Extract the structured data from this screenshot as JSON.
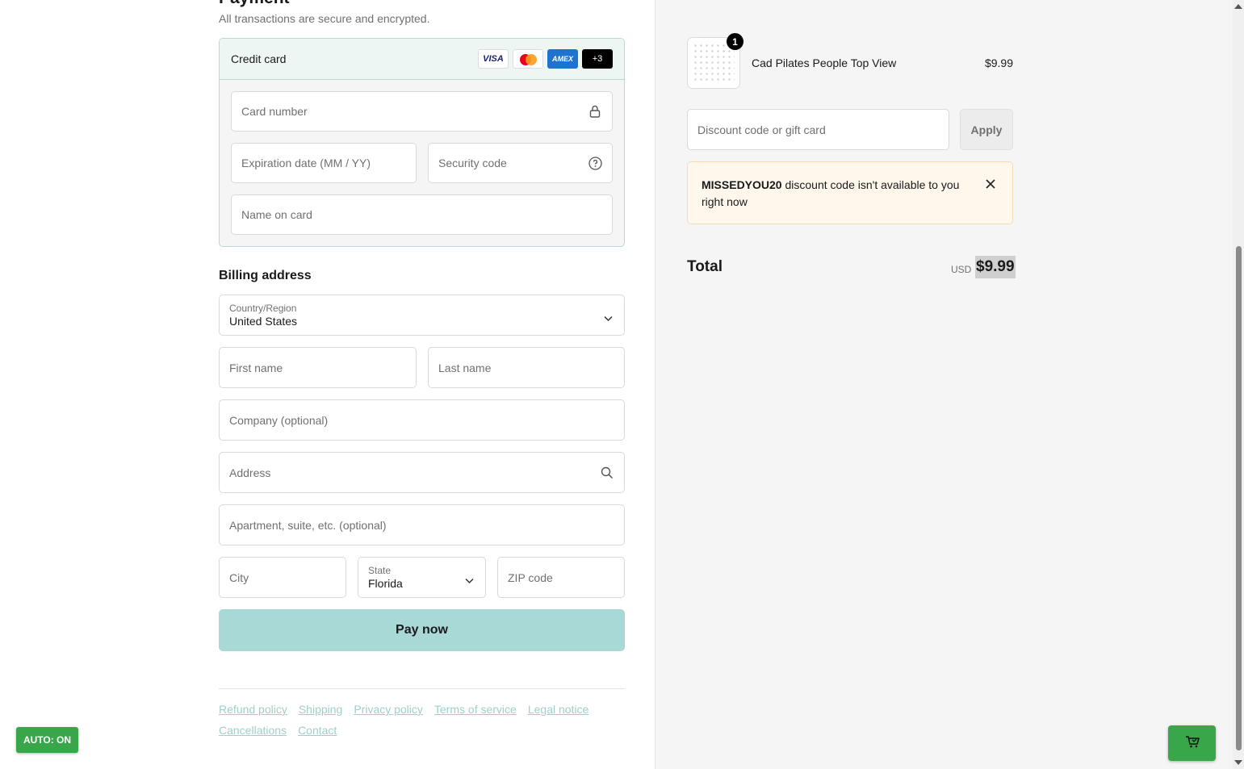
{
  "payment": {
    "heading": "Payment",
    "subtext": "All transactions are secure and encrypted.",
    "method_title": "Credit card",
    "brands": {
      "visa": "VISA",
      "amex": "AMEX",
      "more": "+3"
    },
    "card_number_placeholder": "Card number",
    "expiry_placeholder": "Expiration date (MM / YY)",
    "security_placeholder": "Security code",
    "name_placeholder": "Name on card"
  },
  "billing": {
    "title": "Billing address",
    "country_label": "Country/Region",
    "country_value": "United States",
    "first_name_placeholder": "First name",
    "last_name_placeholder": "Last name",
    "company_placeholder": "Company (optional)",
    "address_placeholder": "Address",
    "apartment_placeholder": "Apartment, suite, etc. (optional)",
    "city_placeholder": "City",
    "state_label": "State",
    "state_value": "Florida",
    "zip_placeholder": "ZIP code"
  },
  "pay_button": "Pay now",
  "footer_links": [
    "Refund policy",
    "Shipping",
    "Privacy policy",
    "Terms of service",
    "Legal notice",
    "Cancellations",
    "Contact"
  ],
  "auto_toggle": "AUTO: ON",
  "summary": {
    "item": {
      "quantity": "1",
      "name": "Cad Pilates People Top View",
      "price": "$9.99"
    },
    "discount_placeholder": "Discount code or gift card",
    "apply_label": "Apply",
    "notice_code": "MISSEDYOU20",
    "notice_text": " discount code isn't available to you right now",
    "total_label": "Total",
    "total_currency": "USD",
    "total_value": "$9.99"
  },
  "colors": {
    "accent": "#a9d9d6",
    "link": "#9fcfc9",
    "green": "#3aa64a",
    "notice_bg": "#fff7ec"
  }
}
